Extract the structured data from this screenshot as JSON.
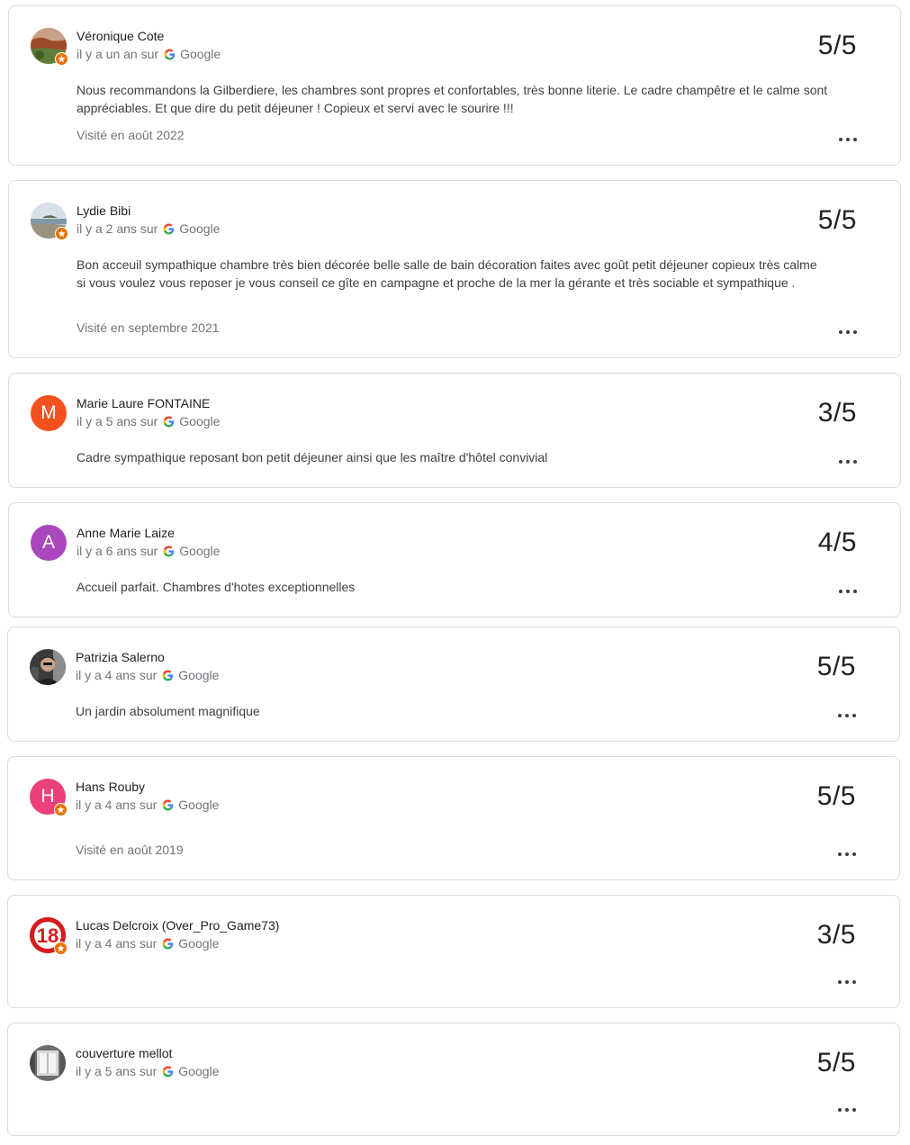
{
  "reviews": [
    {
      "name": "Véronique Cote",
      "time": "il y a un an sur",
      "source": "Google",
      "score": "5/5",
      "text": "Nous recommandons la Gilberdiere, les chambres sont propres et confortables, très bonne literie. Le cadre champêtre et le calme sont appréciables. Et que dire du petit déjeuner ! Copieux et servi avec le sourire !!!",
      "visit": "Visité en août 2022",
      "avatar_type": "photo-landscape",
      "local_guide": true
    },
    {
      "name": "Lydie Bibi",
      "time": "il y a 2 ans sur",
      "source": "Google",
      "score": "5/5",
      "text": "Bon acceuil sympathique chambre très bien décorée belle salle de bain décoration faites avec goût petit déjeuner copieux très calme si vous voulez vous reposer je vous conseil ce gîte en campagne et proche de la mer la gérante et très sociable et sympathique .",
      "visit": "Visité en septembre 2021",
      "avatar_type": "photo-sea",
      "local_guide": true
    },
    {
      "name": "Marie Laure FONTAINE",
      "time": "il y a 5 ans sur",
      "source": "Google",
      "score": "3/5",
      "text": "Cadre sympathique reposant bon petit déjeuner ainsi que les maître d'hôtel convivial",
      "visit": "",
      "avatar_letter": "M",
      "avatar_color": "#f4511e",
      "local_guide": false
    },
    {
      "name": "Anne Marie Laize",
      "time": "il y a 6 ans sur",
      "source": "Google",
      "score": "4/5",
      "text": "Accueil parfait. Chambres d'hotes exceptionnelles",
      "visit": "",
      "avatar_letter": "A",
      "avatar_color": "#ab47bc",
      "local_guide": false
    },
    {
      "name": "Patrizia Salerno",
      "time": "il y a 4 ans sur",
      "source": "Google",
      "score": "5/5",
      "text": "Un jardin absolument magnifique",
      "visit": "",
      "avatar_type": "photo-person",
      "local_guide": false
    },
    {
      "name": "Hans Rouby",
      "time": "il y a 4 ans sur",
      "source": "Google",
      "score": "5/5",
      "text": "",
      "visit": "Visité en août 2019",
      "avatar_letter": "H",
      "avatar_color": "#ec407a",
      "local_guide": true
    },
    {
      "name": "Lucas Delcroix (Over_Pro_Game73)",
      "time": "il y a 4 ans sur",
      "source": "Google",
      "score": "3/5",
      "text": "",
      "visit": "",
      "avatar_type": "photo-number-18",
      "avatar_image_text": "18",
      "local_guide": true
    },
    {
      "name": "couverture mellot",
      "time": "il y a 5 ans sur",
      "source": "Google",
      "score": "5/5",
      "text": "",
      "visit": "",
      "avatar_type": "photo-window",
      "local_guide": false
    }
  ],
  "icons": {
    "source_logo": "google-g-icon",
    "menu": "more-horizontal-icon",
    "local_guide_badge": "star-badge-icon"
  },
  "colors": {
    "border": "#dadce0",
    "secondary_text": "#70757a",
    "badge": "#e8710a"
  }
}
